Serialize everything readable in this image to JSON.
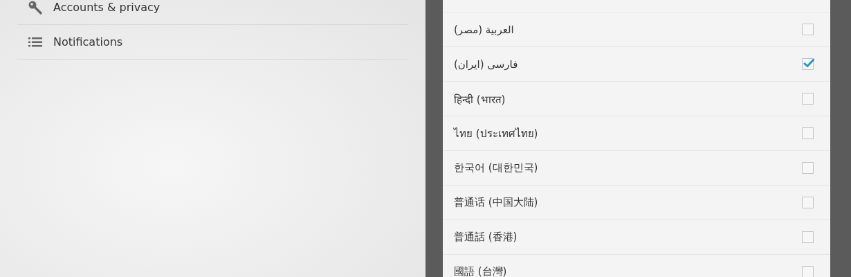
{
  "settings_list": [
    {
      "label": "Accounts & privacy",
      "kind": "key"
    },
    {
      "label": "Notifications",
      "kind": "list"
    }
  ],
  "language_dialog": {
    "languages": [
      {
        "label": "العربية (مصر)",
        "checked": false
      },
      {
        "label": "فارسی (ایران)",
        "checked": true
      },
      {
        "label": "हिन्दी (भारत)",
        "checked": false
      },
      {
        "label": "ไทย (ประเทศไทย)",
        "checked": false
      },
      {
        "label": "한국어 (대한민국)",
        "checked": false
      },
      {
        "label": "普通话 (中国大陆)",
        "checked": false
      },
      {
        "label": "普通話 (香港)",
        "checked": false
      },
      {
        "label": "國語 (台灣)",
        "checked": false
      }
    ]
  }
}
